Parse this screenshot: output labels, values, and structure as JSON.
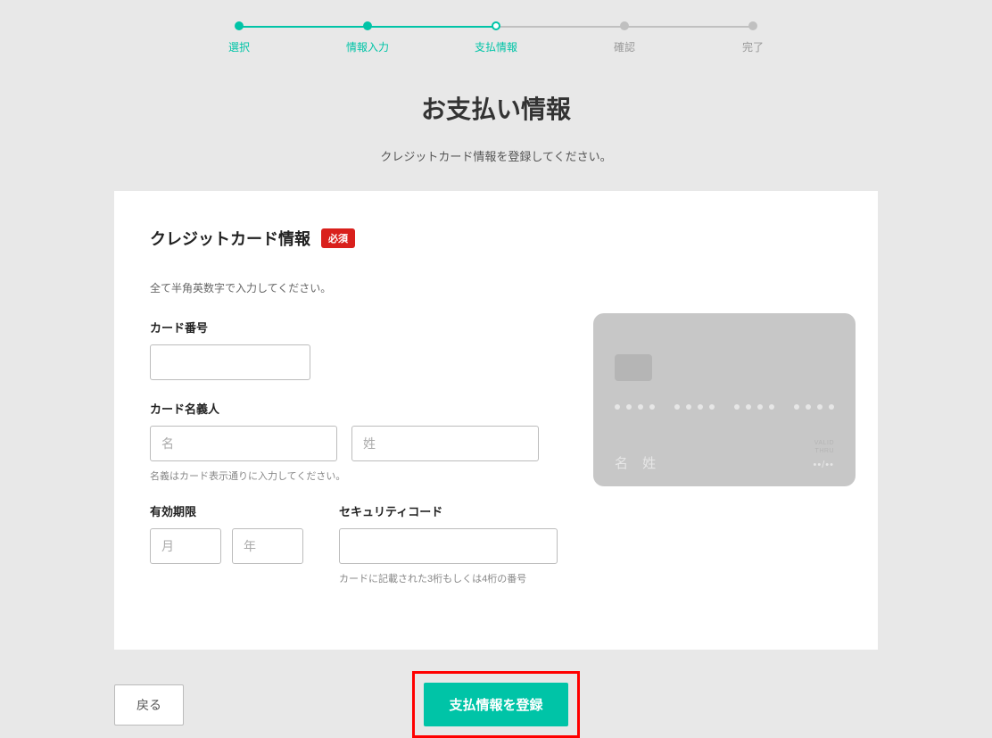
{
  "stepper": {
    "steps": [
      {
        "label": "選択",
        "state": "done"
      },
      {
        "label": "情報入力",
        "state": "done"
      },
      {
        "label": "支払情報",
        "state": "current"
      },
      {
        "label": "確認",
        "state": "future"
      },
      {
        "label": "完了",
        "state": "future"
      }
    ]
  },
  "title": "お支払い情報",
  "subtitle": "クレジットカード情報を登録してください。",
  "section": {
    "title": "クレジットカード情報",
    "required_badge": "必須",
    "hint": "全て半角英数字で入力してください。"
  },
  "fields": {
    "card_number": {
      "label": "カード番号",
      "value": ""
    },
    "card_holder": {
      "label": "カード名義人",
      "first_placeholder": "名",
      "last_placeholder": "姓",
      "first_value": "",
      "last_value": "",
      "help": "名義はカード表示通りに入力してください。"
    },
    "expiry": {
      "label": "有効期限",
      "month_placeholder": "月",
      "year_placeholder": "年",
      "month_value": "",
      "year_value": ""
    },
    "cvc": {
      "label": "セキュリティコード",
      "value": "",
      "help": "カードに記載された3桁もしくは4桁の番号"
    }
  },
  "card_preview": {
    "name": "名 姓",
    "exp_label_top": "VALID",
    "exp_label_bottom": "THRU",
    "exp": "••/••"
  },
  "buttons": {
    "back": "戻る",
    "submit": "支払情報を登録"
  }
}
